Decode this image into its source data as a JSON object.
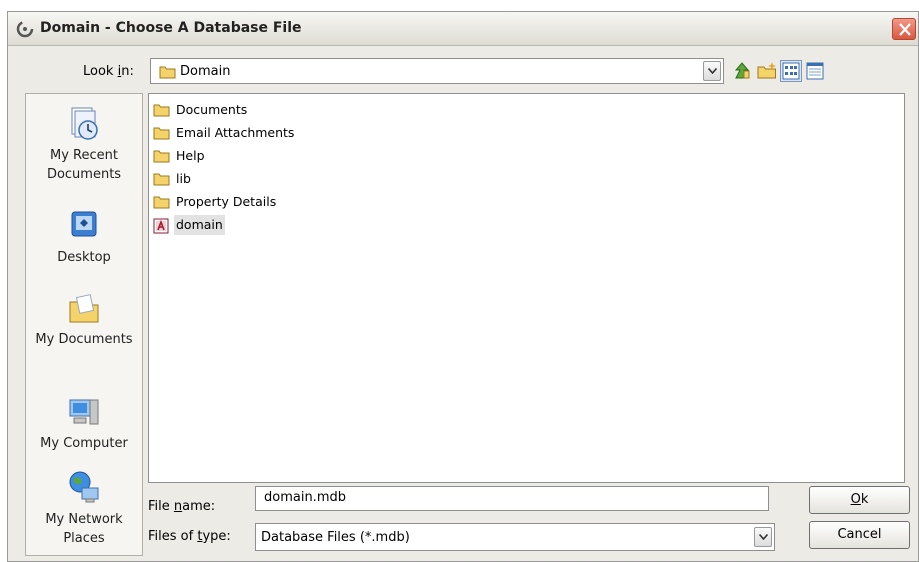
{
  "window": {
    "title": "Domain - Choose A Database File"
  },
  "lookin": {
    "label_pre": "Look ",
    "label_mnemonic": "i",
    "label_post": "n:",
    "value": "Domain"
  },
  "toolbar": {
    "icons": [
      "up-one-level-icon",
      "new-folder-icon",
      "list-view-icon",
      "details-view-icon"
    ]
  },
  "places": [
    {
      "label": "My Recent Documents",
      "icon": "recent-documents-icon"
    },
    {
      "label": "Desktop",
      "icon": "desktop-icon"
    },
    {
      "label": "My Documents",
      "icon": "my-documents-icon"
    },
    {
      "label": "My Computer",
      "icon": "my-computer-icon"
    },
    {
      "label": "My Network Places",
      "icon": "network-places-icon"
    }
  ],
  "files": [
    {
      "name": "Documents",
      "type": "folder"
    },
    {
      "name": "Email Attachments",
      "type": "folder"
    },
    {
      "name": "Help",
      "type": "folder"
    },
    {
      "name": "lib",
      "type": "folder"
    },
    {
      "name": "Property Details",
      "type": "folder"
    },
    {
      "name": "domain",
      "type": "access-database",
      "selected": true
    }
  ],
  "filename": {
    "label_pre": "File ",
    "label_mnemonic": "n",
    "label_post": "ame:",
    "value": "domain.mdb"
  },
  "filetype": {
    "label_pre": "Files of ",
    "label_mnemonic": "t",
    "label_post": "ype:",
    "value": "Database Files (*.mdb)"
  },
  "buttons": {
    "ok_mnemonic": "O",
    "ok_rest": "k",
    "cancel": "Cancel"
  },
  "colors": {
    "folder": "#f5d36b",
    "close": "#d9583e",
    "selection": "#e2e2e2"
  }
}
